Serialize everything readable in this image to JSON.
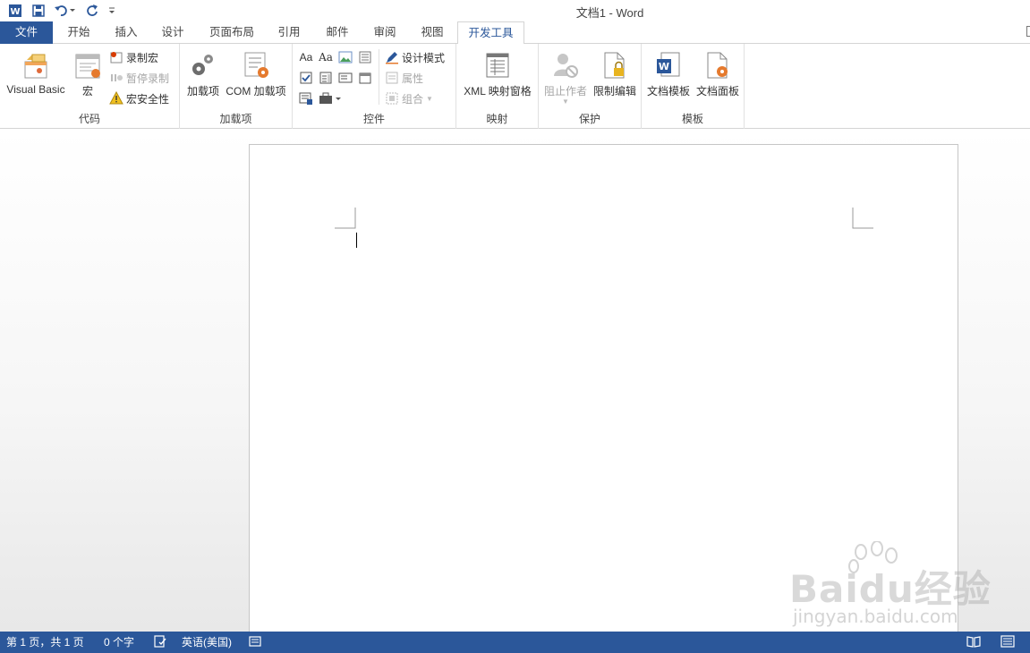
{
  "window": {
    "title": "文档1 - Word"
  },
  "qat": {
    "word_icon": "word-app-icon",
    "save_icon": "save-icon",
    "undo_icon": "undo-icon",
    "redo_icon": "redo-icon",
    "customize_icon": "customize-qat-icon"
  },
  "tabs": [
    {
      "label": "文件"
    },
    {
      "label": "开始"
    },
    {
      "label": "插入"
    },
    {
      "label": "设计"
    },
    {
      "label": "页面布局"
    },
    {
      "label": "引用"
    },
    {
      "label": "邮件"
    },
    {
      "label": "审阅"
    },
    {
      "label": "视图"
    },
    {
      "label": "开发工具"
    }
  ],
  "ribbon": {
    "code": {
      "label": "代码",
      "visual_basic": "Visual Basic",
      "macros": "宏",
      "record_macro": "录制宏",
      "pause_recording": "暂停录制",
      "macro_security": "宏安全性"
    },
    "addins": {
      "label": "加载项",
      "addins_btn": "加载项",
      "com_addins": "COM 加载项"
    },
    "controls": {
      "label": "控件",
      "design_mode": "设计模式",
      "properties": "属性",
      "group": "组合",
      "rich_text": "Aa",
      "plain_text": "Aa"
    },
    "mapping": {
      "label": "映射",
      "xml_pane": "XML 映射窗格"
    },
    "protect": {
      "label": "保护",
      "block_authors": "阻止作者",
      "restrict_editing": "限制编辑"
    },
    "templates": {
      "label": "模板",
      "document_template": "文档模板",
      "document_panel": "文档面板"
    }
  },
  "watermark": {
    "brand": "Baidu经验",
    "url": "jingyan.baidu.com"
  },
  "statusbar": {
    "page": "第 1 页，共 1 页",
    "words": "0 个字",
    "language": "英语(美国)"
  },
  "colors": {
    "accent": "#2b579a",
    "file_tab": "#2b579a",
    "status_bar": "#2b579a"
  }
}
